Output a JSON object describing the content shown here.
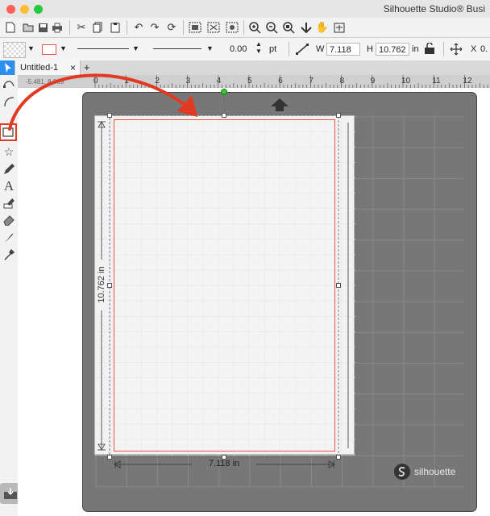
{
  "app": {
    "title": "Silhouette Studio® Busi"
  },
  "window_lights": {
    "close": "#ff5f57",
    "minimize": "#febc2e",
    "maximize": "#28c840"
  },
  "toolbar2": {
    "line_width_value": "0.00",
    "line_width_unit": "pt",
    "width_label": "W",
    "width_value": "7.118",
    "height_label": "H",
    "height_value": "10.762",
    "size_unit": "in",
    "position_x_label": "X",
    "position_x_value": "0."
  },
  "tabs": [
    {
      "label": "Untitled-1",
      "close": "×"
    }
  ],
  "add_tab": "+",
  "ruler": {
    "coordinates": "-5.481, 8.069",
    "ticks": [
      "0",
      "1",
      "2",
      "3",
      "4",
      "5",
      "6",
      "7",
      "8",
      "9",
      "10",
      "11",
      "12"
    ]
  },
  "dimensions": {
    "height_label": "10.762 in",
    "width_label": "7.118 in"
  },
  "mat_brand": "silhouette",
  "colors": {
    "accent_red": "#e8524a",
    "highlight_red": "#e23a22",
    "mat_gray": "#777777",
    "selection_green": "#33cc33"
  },
  "icons": {
    "toolbar1": [
      "new-document-icon",
      "open-icon",
      "save-icon",
      "print-icon",
      "cut-icon",
      "copy-icon",
      "paste-icon",
      "undo-icon",
      "redo-icon",
      "group-icon",
      "ungroup-icon",
      "compound-icon",
      "zoom-in-icon",
      "zoom-out-icon",
      "zoom-fit-icon",
      "move-down-icon",
      "pan-hand-icon",
      "fit-to-page-icon"
    ],
    "left_tools": [
      "select-icon",
      "point-edit-icon",
      "curve-icon",
      "rectangle-icon",
      "star-icon",
      "pencil-icon",
      "text-icon",
      "eraser-icon",
      "knife-icon",
      "eyedropper-icon",
      "pen-icon"
    ]
  }
}
